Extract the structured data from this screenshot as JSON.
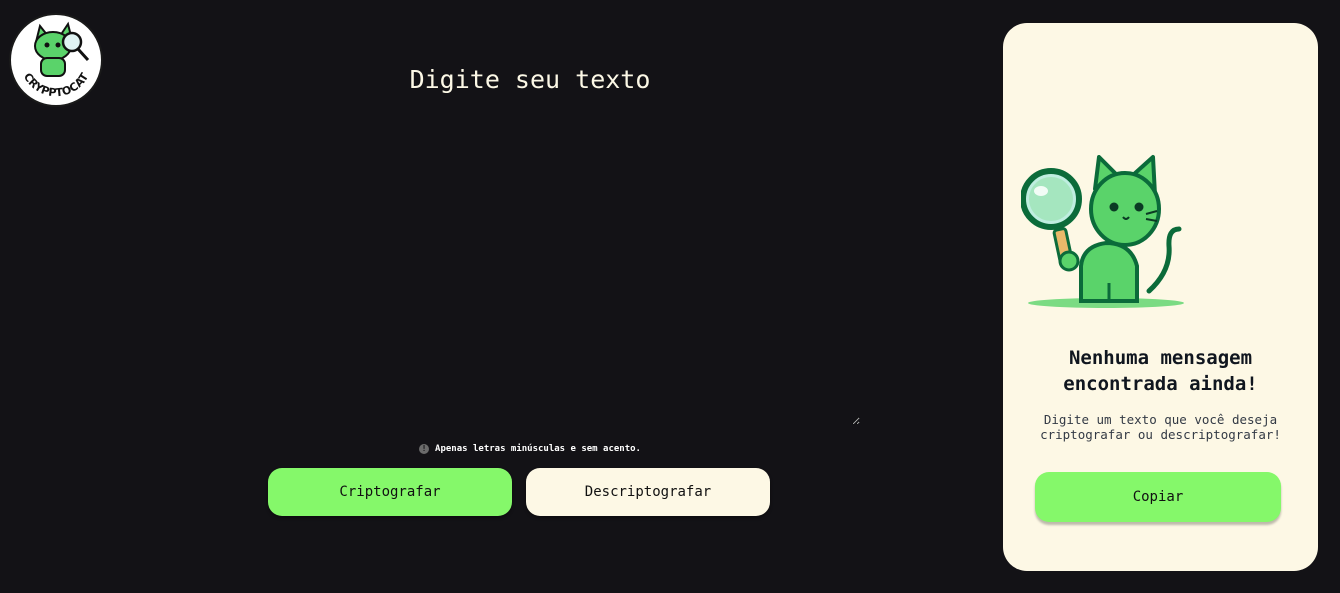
{
  "logo": {
    "text": "CRYPPTOCAT",
    "icon": "cat-logo-icon"
  },
  "input": {
    "placeholder": "Digite seu texto",
    "value": ""
  },
  "hint": {
    "icon": "info-icon",
    "text": "Apenas letras minúsculas e sem acento."
  },
  "actions": {
    "encrypt_label": "Criptografar",
    "decrypt_label": "Descriptografar"
  },
  "output_panel": {
    "illustration": "detective-cat-icon",
    "title": "Nenhuma mensagem\nencontrada ainda!",
    "description": "Digite um texto que você deseja\ncriptografar ou descriptografar!",
    "copy_label": "Copiar"
  },
  "colors": {
    "background": "#131216",
    "accent_green": "#85f86a",
    "cream": "#fdf8e5",
    "cat_green": "#5ad36a",
    "cat_outline": "#0b6b3a"
  }
}
